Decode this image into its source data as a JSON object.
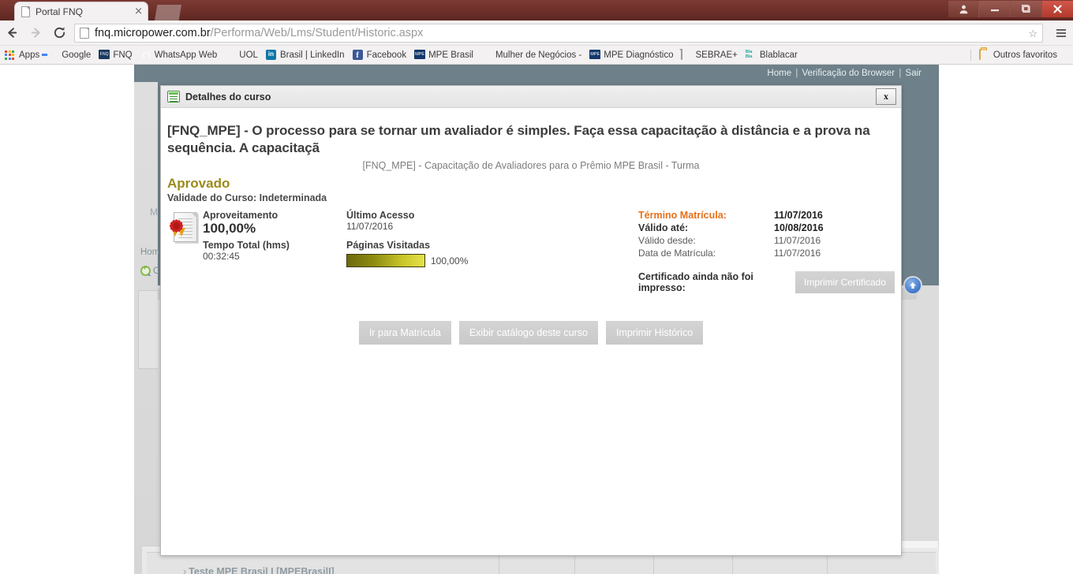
{
  "browser": {
    "tab": {
      "title": "Portal FNQ",
      "close_label": "×",
      "favicon": "page-icon"
    },
    "nav": {
      "back": "←",
      "forward": "→",
      "reload": "⟳",
      "menu": "☰"
    },
    "omnibox": {
      "url_host": "fnq.micropower.com.br",
      "url_path": "/Performa/Web/Lms/Student/Historic.aspx",
      "star": "☆"
    },
    "window_controls": {
      "user": "user-icon",
      "minimize": "–",
      "maximize": "❐",
      "close": "✕"
    },
    "bookmarks": [
      {
        "label": "Apps",
        "icon": "apps-grid-icon"
      },
      {
        "label": "Google",
        "icon": "google-icon"
      },
      {
        "label": "FNQ",
        "icon": "fnq-icon"
      },
      {
        "label": "WhatsApp Web",
        "icon": "whatsapp-icon"
      },
      {
        "label": "UOL",
        "icon": "uol-icon"
      },
      {
        "label": "Brasil | LinkedIn",
        "icon": "linkedin-icon"
      },
      {
        "label": "Facebook",
        "icon": "facebook-icon"
      },
      {
        "label": "MPE Brasil",
        "icon": "mpe-icon"
      },
      {
        "label": "Mulher de Negócios -",
        "icon": "mulher-negocios-icon"
      },
      {
        "label": "MPE Diagnóstico",
        "icon": "mpe-icon"
      },
      {
        "label": "SEBRAE+",
        "icon": "document-icon"
      },
      {
        "label": "Blablacar",
        "icon": "blablacar-icon"
      }
    ],
    "other_bookmarks": {
      "label": "Outros favoritos",
      "icon": "folder-icon"
    }
  },
  "site": {
    "topbar": {
      "home": "Home",
      "browser_check": "Verificação do Browser",
      "logout": "Sair",
      "separator": "|"
    },
    "background_fragments": {
      "m": "M",
      "home": "Home",
      "search": "C"
    },
    "scroll_top_icon": "arrow-up-icon",
    "bottom_row": {
      "caret": "›",
      "label": "Teste MPE Brasil I [MPEBrasilI]"
    }
  },
  "modal": {
    "header": {
      "title": "Detalhes do curso",
      "icon": "course-details-icon",
      "close_label": "x"
    },
    "course_title": "[FNQ_MPE] - O processo para se tornar um avaliador é simples. Faça essa capacitação à distância e a prova na sequência. A capacitaçã",
    "course_subtitle": "[FNQ_MPE] - Capacitação de Avaliadores para o Prêmio MPE Brasil - Turma",
    "status": "Aprovado",
    "validity": "Validade do Curso: Indeterminada",
    "certificate_icon": "certificate-seal-icon",
    "performance": {
      "label": "Aproveitamento",
      "value": "100,00%",
      "time_label": "Tempo Total (hms)",
      "time_value": "00:32:45"
    },
    "access": {
      "last_access_label": "Último Acesso",
      "last_access_value": "11/07/2016",
      "pages_label": "Páginas Visitadas",
      "pages_percent_text": "100,00%",
      "pages_percent_value": 100
    },
    "enrollment": [
      {
        "key": "Término Matrícula:",
        "value": "11/07/2016",
        "style": "highlight"
      },
      {
        "key": "Válido até:",
        "value": "10/08/2016",
        "style": "bold"
      },
      {
        "key": "Válido desde:",
        "value": "11/07/2016",
        "style": "normal"
      },
      {
        "key": "Data de Matrícula:",
        "value": "11/07/2016",
        "style": "normal"
      }
    ],
    "certificate": {
      "text": "Certificado ainda não foi impresso:",
      "button": "Imprimir Certificado"
    },
    "actions": [
      {
        "label": "Ir para Matrícula"
      },
      {
        "label": "Exibir catálogo deste curso"
      },
      {
        "label": "Imprimir Histórico"
      }
    ]
  },
  "colors": {
    "status": "#9b8b1a",
    "accent_orange": "#e8701a",
    "progress_start": "#6d6a0c",
    "progress_end": "#e4e24a",
    "page_background": "#6e8089",
    "titlebar": "#6d2f29"
  }
}
